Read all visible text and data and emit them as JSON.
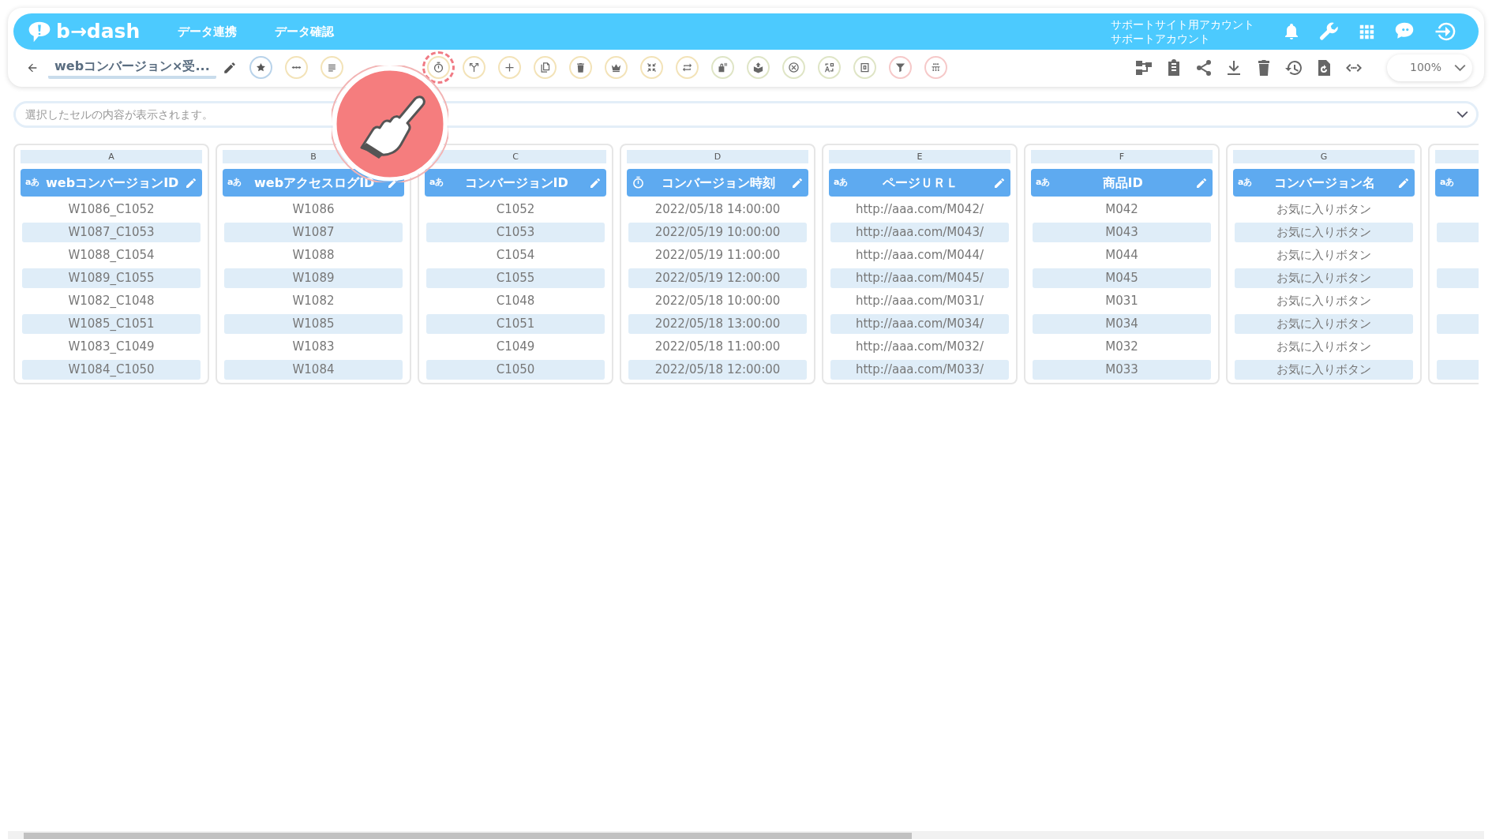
{
  "header": {
    "logo": "b→dash",
    "nav": [
      "データ連携",
      "データ確認"
    ],
    "account": [
      "サポートサイト用アカウント",
      "サポートアカウント"
    ]
  },
  "toolbar": {
    "title": "webコンバージョン×受...",
    "zoom": "100%",
    "tools": [
      {
        "color": "#b9d3ea",
        "highlighted": false
      },
      {
        "color": "#f3e3b8",
        "highlighted": false
      },
      {
        "color": "#f3e3b8",
        "highlighted": false
      },
      {
        "color": "#f3e3b8",
        "highlighted": true
      },
      {
        "color": "#f3e3b8",
        "highlighted": false
      },
      {
        "color": "#f3e3b8",
        "highlighted": false
      },
      {
        "color": "#f3e3b8",
        "highlighted": false
      },
      {
        "color": "#f3e3b8",
        "highlighted": false
      },
      {
        "color": "#f3e3b8",
        "highlighted": false
      },
      {
        "color": "#f3e3b8",
        "highlighted": false
      },
      {
        "color": "#f3e3b8",
        "highlighted": false
      },
      {
        "color": "#dfe5c6",
        "highlighted": false
      },
      {
        "color": "#dfe5c6",
        "highlighted": false
      },
      {
        "color": "#dfe5c6",
        "highlighted": false
      },
      {
        "color": "#dfe5c6",
        "highlighted": false
      },
      {
        "color": "#dfe5c6",
        "highlighted": false
      },
      {
        "color": "#f6c9c9",
        "highlighted": false
      },
      {
        "color": "#f6c9c9",
        "highlighted": false
      }
    ]
  },
  "formula_bar": {
    "placeholder": "選択したセルの内容が表示されます。"
  },
  "columns": [
    {
      "letter": "A",
      "kind": "text",
      "type_label": "aあ",
      "name": "webコンバージョンID",
      "cells": [
        "W1086_C1052",
        "W1087_C1053",
        "W1088_C1054",
        "W1089_C1055",
        "W1082_C1048",
        "W1085_C1051",
        "W1083_C1049",
        "W1084_C1050"
      ]
    },
    {
      "letter": "B",
      "kind": "text",
      "type_label": "aあ",
      "name": "webアクセスログID",
      "cells": [
        "W1086",
        "W1087",
        "W1088",
        "W1089",
        "W1082",
        "W1085",
        "W1083",
        "W1084"
      ]
    },
    {
      "letter": "C",
      "kind": "text",
      "type_label": "aあ",
      "name": "コンバージョンID",
      "cells": [
        "C1052",
        "C1053",
        "C1054",
        "C1055",
        "C1048",
        "C1051",
        "C1049",
        "C1050"
      ]
    },
    {
      "letter": "D",
      "kind": "datetime",
      "name": "コンバージョン時刻",
      "cells": [
        "2022/05/18 14:00:00",
        "2022/05/19 10:00:00",
        "2022/05/19 11:00:00",
        "2022/05/19 12:00:00",
        "2022/05/18 10:00:00",
        "2022/05/18 13:00:00",
        "2022/05/18 11:00:00",
        "2022/05/18 12:00:00"
      ]
    },
    {
      "letter": "E",
      "kind": "text",
      "type_label": "aあ",
      "name": "ページＵＲＬ",
      "cells": [
        "http://aaa.com/M042/",
        "http://aaa.com/M043/",
        "http://aaa.com/M044/",
        "http://aaa.com/M045/",
        "http://aaa.com/M031/",
        "http://aaa.com/M034/",
        "http://aaa.com/M032/",
        "http://aaa.com/M033/"
      ]
    },
    {
      "letter": "F",
      "kind": "text",
      "type_label": "aあ",
      "name": "商品ID",
      "cells": [
        "M042",
        "M043",
        "M044",
        "M045",
        "M031",
        "M034",
        "M032",
        "M033"
      ]
    },
    {
      "letter": "G",
      "kind": "text",
      "type_label": "aあ",
      "name": "コンバージョン名",
      "cells": [
        "お気に入りボタン",
        "お気に入りボタン",
        "お気に入りボタン",
        "お気に入りボタン",
        "お気に入りボタン",
        "お気に入りボタン",
        "お気に入りボタン",
        "お気に入りボタン"
      ]
    },
    {
      "kind": "text",
      "type_label": "aあ"
    }
  ]
}
